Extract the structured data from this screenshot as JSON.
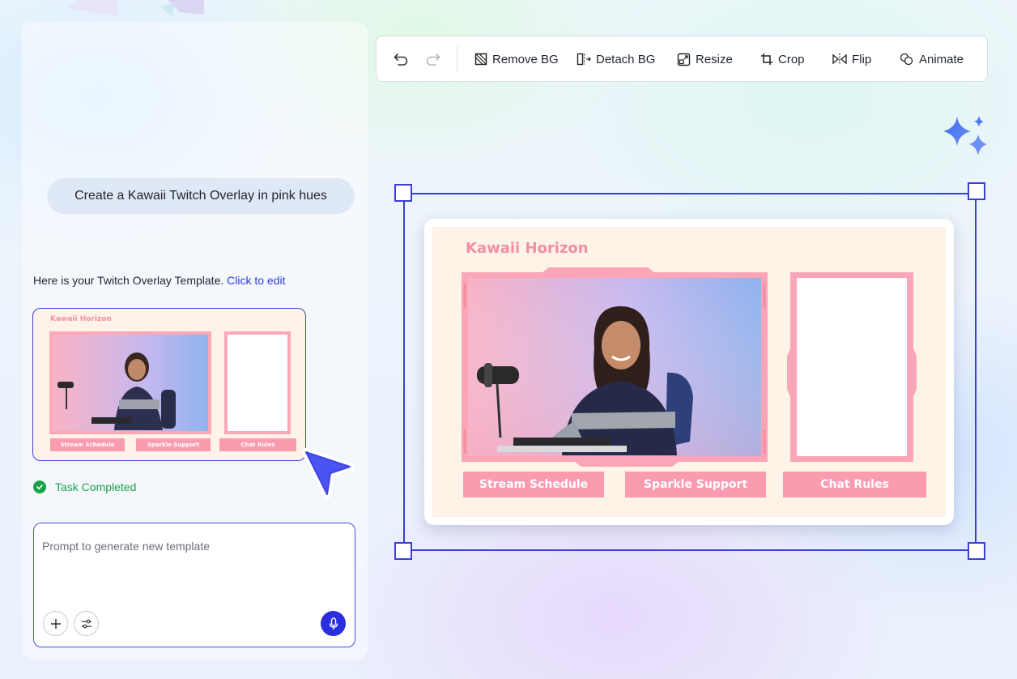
{
  "chat": {
    "user_prompt": "Create a Kawaii Twitch Overlay in pink hues",
    "reply_text": "Here is your Twitch Overlay Template. ",
    "reply_link": "Click to edit",
    "status": "Task Completed"
  },
  "overlay": {
    "title": "Kawaii Horizon",
    "labels": [
      "Stream Schedule",
      "Sparkle Support",
      "Chat Rules"
    ]
  },
  "composer": {
    "placeholder": "Prompt to generate new template"
  },
  "toolbar": {
    "undo_icon": "undo-icon",
    "redo_icon": "redo-icon",
    "items": [
      {
        "label": "Remove BG",
        "icon": "remove-bg-icon"
      },
      {
        "label": "Detach BG",
        "icon": "detach-bg-icon"
      },
      {
        "label": "Resize",
        "icon": "resize-icon"
      },
      {
        "label": "Crop",
        "icon": "crop-icon"
      },
      {
        "label": "Flip",
        "icon": "flip-icon"
      },
      {
        "label": "Animate",
        "icon": "animate-icon"
      }
    ]
  },
  "colors": {
    "accent": "#3b3fd4",
    "success": "#17a34a",
    "overlay_pink": "#fb9bb0",
    "overlay_bg": "#fdf3e6"
  }
}
